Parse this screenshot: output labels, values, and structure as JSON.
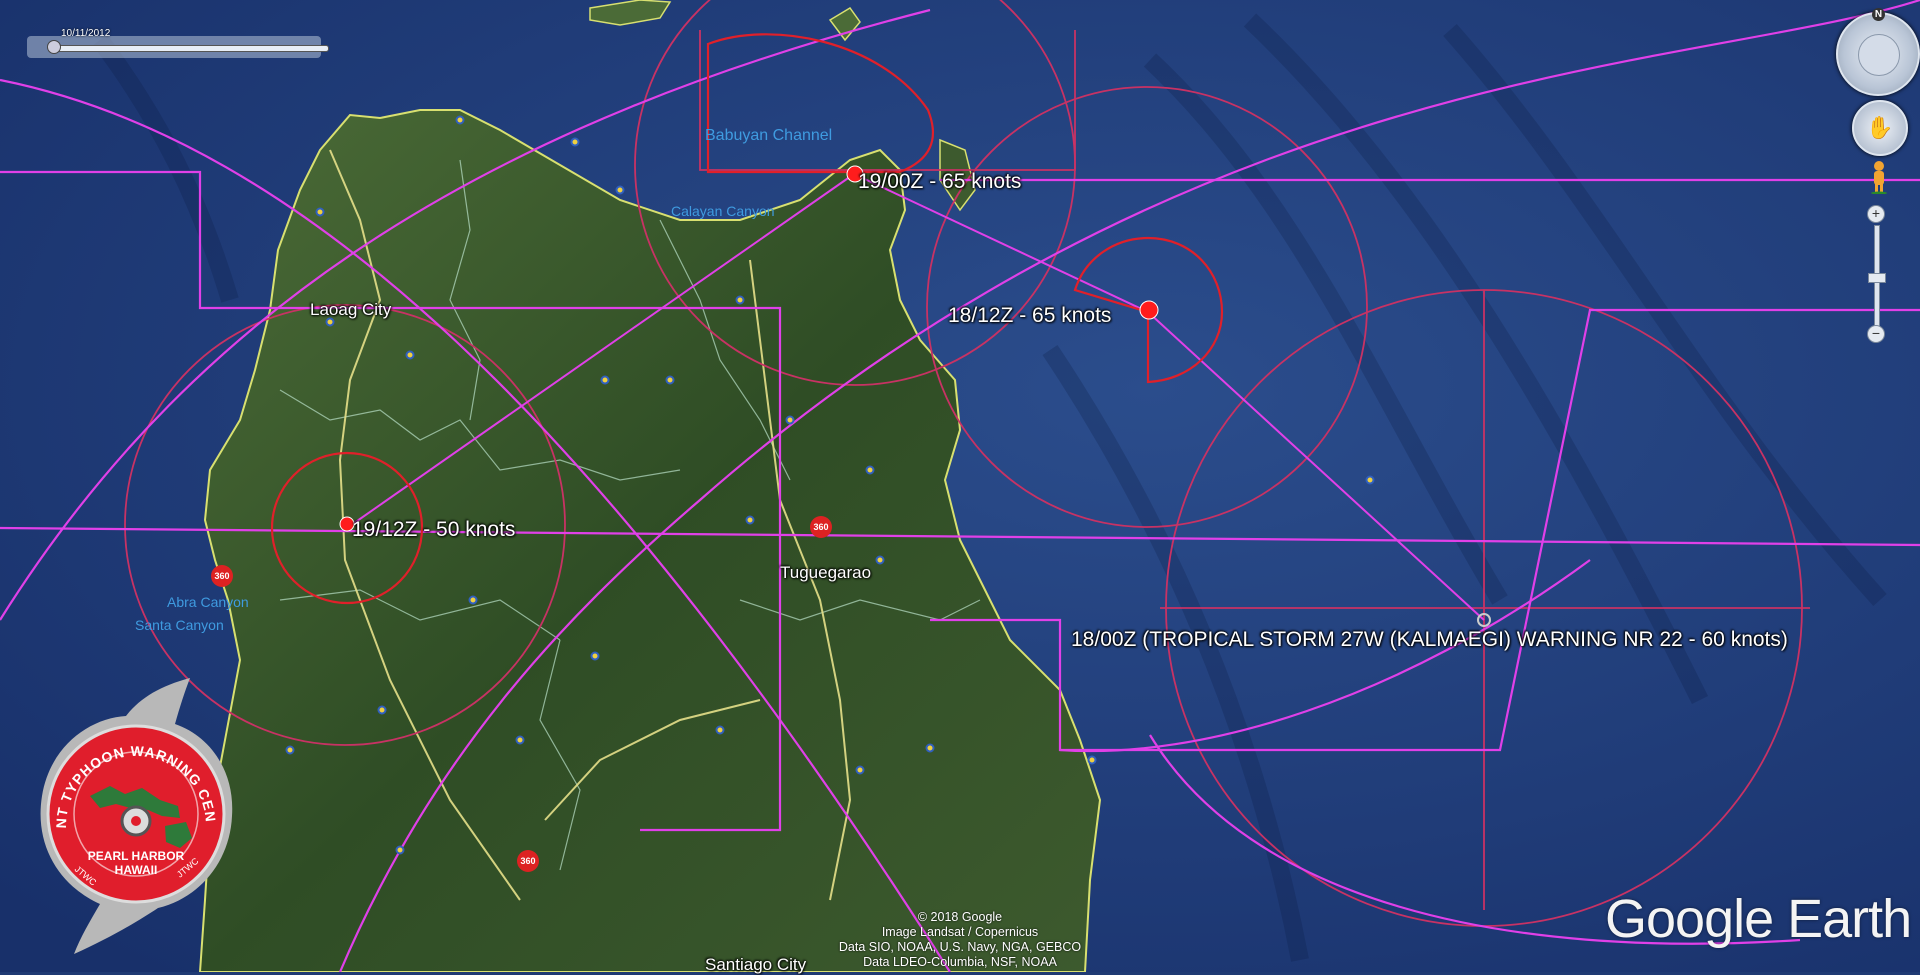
{
  "timeline": {
    "date": "10/11/2012"
  },
  "storm_positions": [
    {
      "label": "19/00Z - 65 knots"
    },
    {
      "label": "18/12Z - 65 knots"
    },
    {
      "label": "19/12Z - 50 knots"
    },
    {
      "label": "18/00Z (TROPICAL STORM 27W (KALMAEGI) WARNING NR 22    - 60 knots)"
    }
  ],
  "places": {
    "laoag": "Laoag City",
    "tuguegarao": "Tuguegarao",
    "santiago": "Santiago City"
  },
  "water_features": {
    "babuyan": "Babuyan Channel",
    "calayan": "Calayan Canyon",
    "abra": "Abra Canyon",
    "santa": "Santa Canyon"
  },
  "badge_text": "360",
  "logo": {
    "arc_text": "JOINT TYPHOON WARNING CENTER",
    "line1": "PEARL HARBOR",
    "line2": "HAWAII",
    "side_left": "JTWC",
    "side_right": "JTWC"
  },
  "compass_label": "N",
  "zoom": {
    "plus": "+",
    "minus": "−"
  },
  "copyright": [
    "© 2018 Google",
    "Image Landsat / Copernicus",
    "Data SIO, NOAA, U.S. Navy, NGA, GEBCO",
    "Data LDEO-Columbia, NSF, NOAA"
  ],
  "brand": "Google Earth",
  "colors": {
    "ocean": "#203c78",
    "land": "#3b5a2c",
    "track_line": "#e040e8",
    "danger_area": "#c83264",
    "wind_radii": "#e0202a",
    "coast": "#d8e070"
  }
}
